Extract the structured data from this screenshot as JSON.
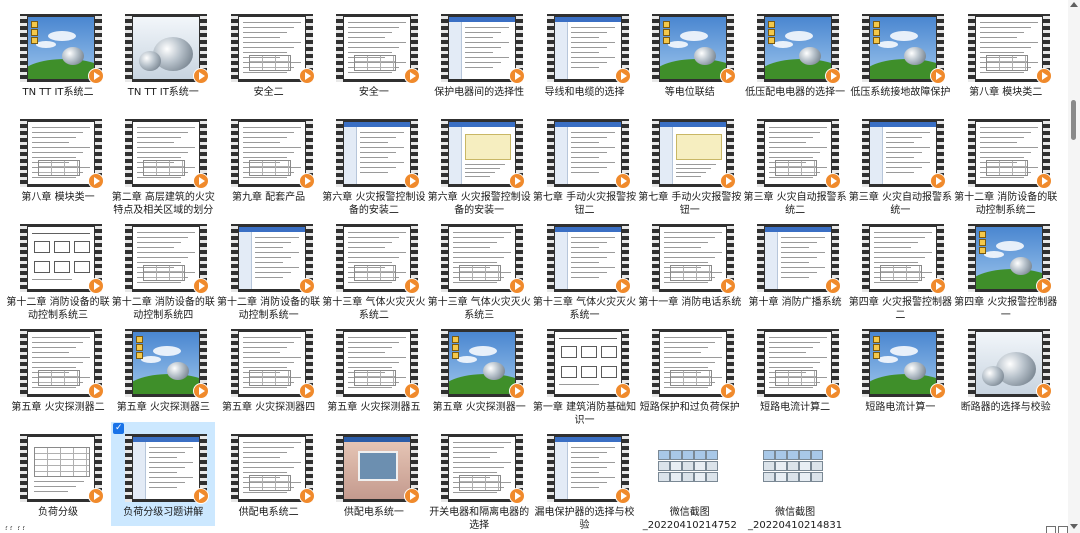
{
  "items": [
    {
      "label": "TN TT IT系统二",
      "kind": "desktop"
    },
    {
      "label": "TN TT IT系统一",
      "kind": "sphere"
    },
    {
      "label": "安全二",
      "kind": "doc"
    },
    {
      "label": "安全一",
      "kind": "doc"
    },
    {
      "label": "保护电器间的选择性",
      "kind": "app"
    },
    {
      "label": "导线和电缆的选择",
      "kind": "app"
    },
    {
      "label": "等电位联结",
      "kind": "desktop"
    },
    {
      "label": "低压配电电器的选择一",
      "kind": "desktop"
    },
    {
      "label": "低压系统接地故障保护",
      "kind": "desktop"
    },
    {
      "label": "第八章 模块类二",
      "kind": "doc"
    },
    {
      "label": "第八章 模块类一",
      "kind": "doc"
    },
    {
      "label": "第二章 高层建筑的火灾特点及相关区域的划分",
      "kind": "doc"
    },
    {
      "label": "第九章 配套产品",
      "kind": "doc"
    },
    {
      "label": "第六章 火灾报警控制设备的安装二",
      "kind": "app"
    },
    {
      "label": "第六章 火灾报警控制设备的安装一",
      "kind": "yellow"
    },
    {
      "label": "第七章 手动火灾报警按钮二",
      "kind": "app"
    },
    {
      "label": "第七章 手动火灾报警按钮一",
      "kind": "yellow"
    },
    {
      "label": "第三章 火灾自动报警系统二",
      "kind": "doc"
    },
    {
      "label": "第三章 火灾自动报警系统一",
      "kind": "app"
    },
    {
      "label": "第十二章 消防设备的联动控制系统二",
      "kind": "doc"
    },
    {
      "label": "第十二章 消防设备的联动控制系统三",
      "kind": "diagram"
    },
    {
      "label": "第十二章 消防设备的联动控制系统四",
      "kind": "doc"
    },
    {
      "label": "第十二章 消防设备的联动控制系统一",
      "kind": "app"
    },
    {
      "label": "第十三章 气体火灾灭火系统二",
      "kind": "doc"
    },
    {
      "label": "第十三章 气体火灾灭火系统三",
      "kind": "doc"
    },
    {
      "label": "第十三章 气体火灾灭火系统一",
      "kind": "app"
    },
    {
      "label": "第十一章 消防电话系统",
      "kind": "doc"
    },
    {
      "label": "第十章 消防广播系统",
      "kind": "app"
    },
    {
      "label": "第四章 火灾报警控制器二",
      "kind": "doc"
    },
    {
      "label": "第四章 火灾报警控制器一",
      "kind": "desktop"
    },
    {
      "label": "第五章 火灾探测器二",
      "kind": "doc"
    },
    {
      "label": "第五章 火灾探测器三",
      "kind": "desktop"
    },
    {
      "label": "第五章 火灾探测器四",
      "kind": "doc"
    },
    {
      "label": "第五章 火灾探测器五",
      "kind": "doc"
    },
    {
      "label": "第五章 火灾探测器一",
      "kind": "desktop"
    },
    {
      "label": "第一章 建筑消防基础知识一",
      "kind": "diagram"
    },
    {
      "label": "短路保护和过负荷保护",
      "kind": "doc"
    },
    {
      "label": "短路电流计算二",
      "kind": "doc"
    },
    {
      "label": "短路电流计算一",
      "kind": "desktop"
    },
    {
      "label": "断路器的选择与校验",
      "kind": "sphere"
    },
    {
      "label": "负荷分级",
      "kind": "table"
    },
    {
      "label": "负荷分级习题讲解",
      "kind": "app",
      "selected": true
    },
    {
      "label": "供配电系统二",
      "kind": "doc"
    },
    {
      "label": "供配电系统一",
      "kind": "photo"
    },
    {
      "label": "开关电器和隔离电器的选择",
      "kind": "doc"
    },
    {
      "label": "漏电保护器的选择与校验",
      "kind": "app"
    },
    {
      "label": "微信截图_20220410214752",
      "kind": "image"
    },
    {
      "label": "微信截图_20220410214831",
      "kind": "image"
    }
  ],
  "status": {
    "text": "?? ??"
  },
  "colors": {
    "selection": "#cce8ff",
    "play": "#f08a2c",
    "check": "#1a73e8"
  }
}
